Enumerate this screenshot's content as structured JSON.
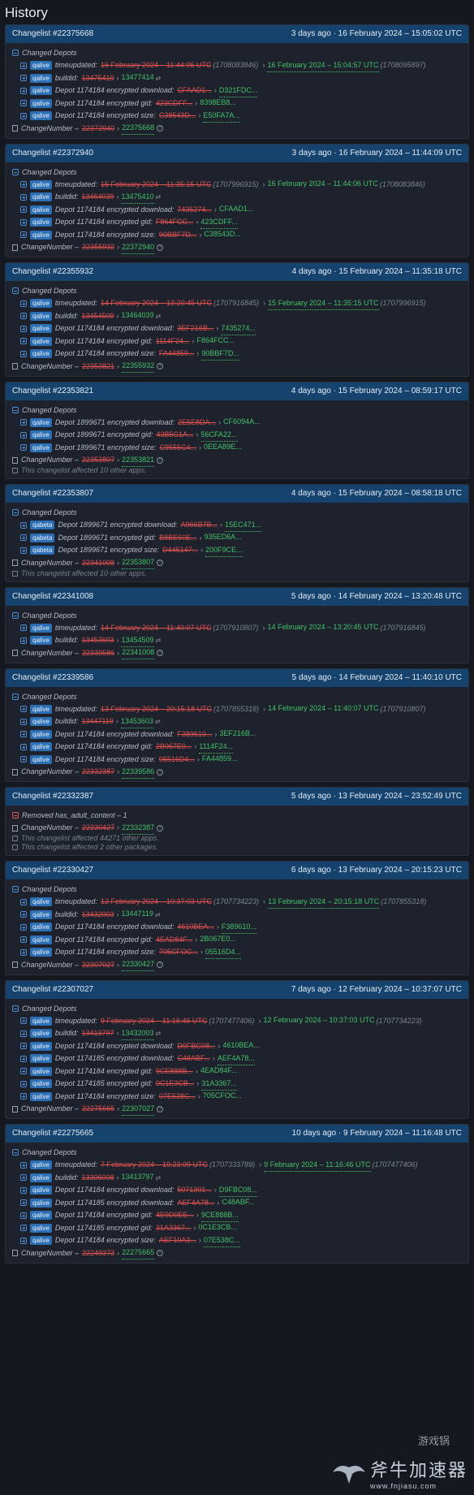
{
  "page": {
    "title": "History"
  },
  "changelists": [
    {
      "id": "Changelist #22375668",
      "date": "3 days ago · 16 February 2024 – 15:05:02 UTC",
      "section": "Changed Depots",
      "section_kind": "changed",
      "rows": [
        {
          "tag": "qalive",
          "key": "timeupdated:",
          "old": "16 February 2024 – 11:44:06 UTC",
          "old_ts": "(1708083846)",
          "new": "16 February 2024 – 15:04:57 UTC",
          "new_ts": "(1708095897)"
        },
        {
          "tag": "qalive",
          "key": "buildid:",
          "old": "13475410",
          "new": "13477414",
          "hist": true
        },
        {
          "tag": "qalive",
          "key": "Depot 1174184 encrypted download:",
          "old": "CFAAD1...",
          "new": "D321FDC..."
        },
        {
          "tag": "qalive",
          "key": "Depot 1174184 encrypted gid:",
          "old": "423CDFF...",
          "new": "8398EB8..."
        },
        {
          "tag": "qalive",
          "key": "Depot 1174184 encrypted size:",
          "old": "C38543D...",
          "new": "E50FA7A..."
        }
      ],
      "change_label": "ChangeNumber –",
      "change_old": "22372940",
      "change_new": "22375668",
      "notes": []
    },
    {
      "id": "Changelist #22372940",
      "date": "3 days ago · 16 February 2024 – 11:44:09 UTC",
      "section": "Changed Depots",
      "section_kind": "changed",
      "rows": [
        {
          "tag": "qalive",
          "key": "timeupdated:",
          "old": "15 February 2024 – 11:35:15 UTC",
          "old_ts": "(1707996915)",
          "new": "16 February 2024 – 11:44:06 UTC",
          "new_ts": "(1708083846)"
        },
        {
          "tag": "qalive",
          "key": "buildid:",
          "old": "13464039",
          "new": "13475410",
          "hist": true
        },
        {
          "tag": "qalive",
          "key": "Depot 1174184 encrypted download:",
          "old": "7435274...",
          "new": "CFAAD1..."
        },
        {
          "tag": "qalive",
          "key": "Depot 1174184 encrypted gid:",
          "old": "F864FCC...",
          "new": "423CDFF..."
        },
        {
          "tag": "qalive",
          "key": "Depot 1174184 encrypted size:",
          "old": "90BBF7D...",
          "new": "C38543D..."
        }
      ],
      "change_label": "ChangeNumber –",
      "change_old": "22355932",
      "change_new": "22372940",
      "notes": []
    },
    {
      "id": "Changelist #22355932",
      "date": "4 days ago · 15 February 2024 – 11:35:18 UTC",
      "section": "Changed Depots",
      "section_kind": "changed",
      "rows": [
        {
          "tag": "qalive",
          "key": "timeupdated:",
          "old": "14 February 2024 – 13:20:45 UTC",
          "old_ts": "(1707916845)",
          "new": "15 February 2024 – 11:35:15 UTC",
          "new_ts": "(1707996915)"
        },
        {
          "tag": "qalive",
          "key": "buildid:",
          "old": "13454509",
          "new": "13464039",
          "hist": true
        },
        {
          "tag": "qalive",
          "key": "Depot 1174184 encrypted download:",
          "old": "3EF216B...",
          "new": "7435274..."
        },
        {
          "tag": "qalive",
          "key": "Depot 1174184 encrypted gid:",
          "old": "1114F24...",
          "new": "F864FCC..."
        },
        {
          "tag": "qalive",
          "key": "Depot 1174184 encrypted size:",
          "old": "FA44859...",
          "new": "90BBF7D..."
        }
      ],
      "change_label": "ChangeNumber –",
      "change_old": "22353821",
      "change_new": "22355932",
      "notes": []
    },
    {
      "id": "Changelist #22353821",
      "date": "4 days ago · 15 February 2024 – 08:59:17 UTC",
      "section": "Changed Depots",
      "section_kind": "changed",
      "rows": [
        {
          "tag": "qalive",
          "key": "Depot 1899671 encrypted download:",
          "old": "2E5E8DA...",
          "new": "CF6094A..."
        },
        {
          "tag": "qalive",
          "key": "Depot 1899671 encrypted gid:",
          "old": "43B5C1A...",
          "new": "56CFA22..."
        },
        {
          "tag": "qalive",
          "key": "Depot 1899671 encrypted size:",
          "old": "C9555C4...",
          "new": "0EEA89E..."
        }
      ],
      "change_label": "ChangeNumber –",
      "change_old": "22353807",
      "change_new": "22353821",
      "notes": [
        "This changelist affected 10 other apps."
      ]
    },
    {
      "id": "Changelist #22353807",
      "date": "4 days ago · 15 February 2024 – 08:58:18 UTC",
      "section": "Changed Depots",
      "section_kind": "changed",
      "rows": [
        {
          "tag": "qabeta",
          "key": "Depot 1899671 encrypted download:",
          "old": "A966B7B...",
          "new": "15EC471..."
        },
        {
          "tag": "qabeta",
          "key": "Depot 1899671 encrypted gid:",
          "old": "B8BE60E...",
          "new": "935ED6A..."
        },
        {
          "tag": "qabeta",
          "key": "Depot 1899671 encrypted size:",
          "old": "D445147...",
          "new": "200F9CE..."
        }
      ],
      "change_label": "ChangeNumber –",
      "change_old": "22341008",
      "change_new": "22353807",
      "notes": [
        "This changelist affected 10 other apps."
      ]
    },
    {
      "id": "Changelist #22341008",
      "date": "5 days ago · 14 February 2024 – 13:20:48 UTC",
      "section": "Changed Depots",
      "section_kind": "changed",
      "rows": [
        {
          "tag": "qalive",
          "key": "timeupdated:",
          "old": "14 February 2024 – 11:40:07 UTC",
          "old_ts": "(1707910807)",
          "new": "14 February 2024 – 13:20:45 UTC",
          "new_ts": "(1707916845)"
        },
        {
          "tag": "qalive",
          "key": "buildid:",
          "old": "13453603",
          "new": "13454509",
          "hist": true
        }
      ],
      "change_label": "ChangeNumber –",
      "change_old": "22339586",
      "change_new": "22341008",
      "notes": []
    },
    {
      "id": "Changelist #22339586",
      "date": "5 days ago · 14 February 2024 – 11:40:10 UTC",
      "section": "Changed Depots",
      "section_kind": "changed",
      "rows": [
        {
          "tag": "qalive",
          "key": "timeupdated:",
          "old": "13 February 2024 – 20:15:18 UTC",
          "old_ts": "(1707855318)",
          "new": "14 February 2024 – 11:40:07 UTC",
          "new_ts": "(1707910807)"
        },
        {
          "tag": "qalive",
          "key": "buildid:",
          "old": "13447119",
          "new": "13453603",
          "hist": true
        },
        {
          "tag": "qalive",
          "key": "Depot 1174184 encrypted download:",
          "old": "F389610...",
          "new": "3EF216B..."
        },
        {
          "tag": "qalive",
          "key": "Depot 1174184 encrypted gid:",
          "old": "2B067E0...",
          "new": "1114F24..."
        },
        {
          "tag": "qalive",
          "key": "Depot 1174184 encrypted size:",
          "old": "05516D4...",
          "new": "FA44859..."
        }
      ],
      "change_label": "ChangeNumber –",
      "change_old": "22332387",
      "change_new": "22339586",
      "notes": []
    },
    {
      "id": "Changelist #22332387",
      "date": "5 days ago · 13 February 2024 – 23:52:49 UTC",
      "section": "Removed has_adult_content – 1",
      "section_kind": "removed",
      "rows": [],
      "change_label": "ChangeNumber –",
      "change_old": "22330427",
      "change_new": "22332387",
      "notes": [
        "This changelist affected 44271 other apps.",
        "This changelist affected 2 other packages."
      ]
    },
    {
      "id": "Changelist #22330427",
      "date": "6 days ago · 13 February 2024 – 20:15:23 UTC",
      "section": "Changed Depots",
      "section_kind": "changed",
      "rows": [
        {
          "tag": "qalive",
          "key": "timeupdated:",
          "old": "12 February 2024 – 10:37:03 UTC",
          "old_ts": "(1707734223)",
          "new": "13 February 2024 – 20:15:18 UTC",
          "new_ts": "(1707855318)"
        },
        {
          "tag": "qalive",
          "key": "buildid:",
          "old": "13432003",
          "new": "13447119",
          "hist": true
        },
        {
          "tag": "qalive",
          "key": "Depot 1174184 encrypted download:",
          "old": "4610BEA...",
          "new": "F389610..."
        },
        {
          "tag": "qalive",
          "key": "Depot 1174184 encrypted gid:",
          "old": "4EAD84F...",
          "new": "2B067E0..."
        },
        {
          "tag": "qalive",
          "key": "Depot 1174184 encrypted size:",
          "old": "705CFOC...",
          "new": "05516D4..."
        }
      ],
      "change_label": "ChangeNumber –",
      "change_old": "22307027",
      "change_new": "22330427",
      "notes": []
    },
    {
      "id": "Changelist #22307027",
      "date": "7 days ago · 12 February 2024 – 10:37:07 UTC",
      "section": "Changed Depots",
      "section_kind": "changed",
      "rows": [
        {
          "tag": "qalive",
          "key": "timeupdated:",
          "old": "9 February 2024 – 11:16:46 UTC",
          "old_ts": "(1707477406)",
          "new": "12 February 2024 – 10:37:03 UTC",
          "new_ts": "(1707734223)"
        },
        {
          "tag": "qalive",
          "key": "buildid:",
          "old": "13413797",
          "new": "13432003",
          "hist": true
        },
        {
          "tag": "qalive",
          "key": "Depot 1174184 encrypted download:",
          "old": "D9FBC08...",
          "new": "4610BEA..."
        },
        {
          "tag": "qalive",
          "key": "Depot 1174185 encrypted download:",
          "old": "C48ABF...",
          "new": "AEF4A78..."
        },
        {
          "tag": "qalive",
          "key": "Depot 1174184 encrypted gid:",
          "old": "9CE888B...",
          "new": "4EAD84F..."
        },
        {
          "tag": "qalive",
          "key": "Depot 1174185 encrypted gid:",
          "old": "0C1E3CB...",
          "new": "31A3367..."
        },
        {
          "tag": "qalive",
          "key": "Depot 1174184 encrypted size:",
          "old": "07E538C...",
          "new": "705CFOC..."
        }
      ],
      "change_label": "ChangeNumber –",
      "change_old": "22275665",
      "change_new": "22307027",
      "notes": []
    },
    {
      "id": "Changelist #22275665",
      "date": "10 days ago · 9 February 2024 – 11:16:48 UTC",
      "section": "Changed Depots",
      "section_kind": "changed",
      "rows": [
        {
          "tag": "qalive",
          "key": "timeupdated:",
          "old": "7 February 2024 – 19:23:09 UTC",
          "old_ts": "(1707333789)",
          "new": "9 February 2024 – 11:16:46 UTC",
          "new_ts": "(1707477406)"
        },
        {
          "tag": "qalive",
          "key": "buildid:",
          "old": "13306008",
          "new": "13413797",
          "hist": true
        },
        {
          "tag": "qalive",
          "key": "Depot 1174184 encrypted download:",
          "old": "5071301...",
          "new": "D9FBC08..."
        },
        {
          "tag": "qalive",
          "key": "Depot 1174185 encrypted download:",
          "old": "AEF4A78...",
          "new": "C48ABF..."
        },
        {
          "tag": "qalive",
          "key": "Depot 1174184 encrypted gid:",
          "old": "4E9D0EE...",
          "new": "9CE888B..."
        },
        {
          "tag": "qalive",
          "key": "Depot 1174185 encrypted gid:",
          "old": "31A3367...",
          "new": "0C1E3CB..."
        },
        {
          "tag": "qalive",
          "key": "Depot 1174184 encrypted size:",
          "old": "AEF10A3...",
          "new": "07E538C..."
        }
      ],
      "change_label": "ChangeNumber –",
      "change_old": "22249373",
      "change_new": "22275665",
      "notes": []
    }
  ],
  "watermark": {
    "name": "斧牛加速器",
    "url": "www.fnjiasu.com",
    "corner": "游戏锅"
  }
}
